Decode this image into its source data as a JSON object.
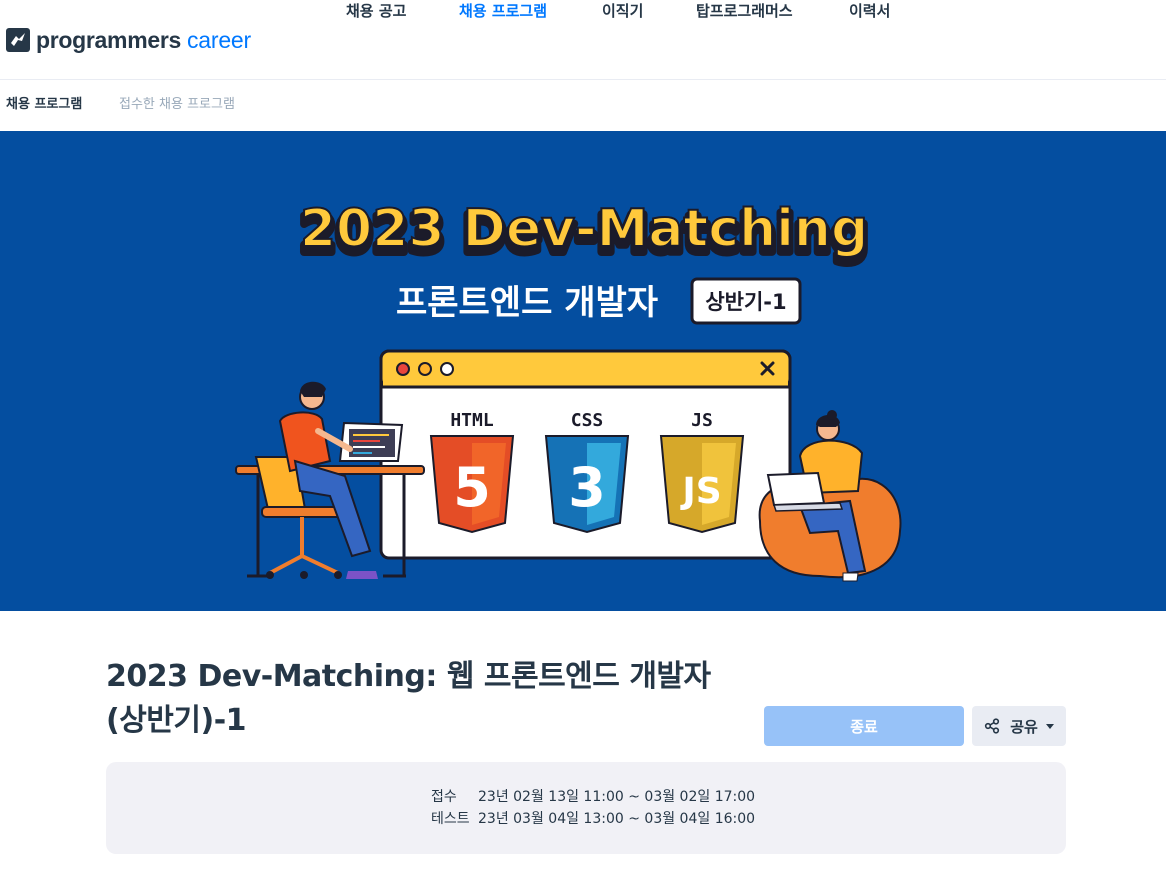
{
  "brand": {
    "name": "programmers",
    "suffix": "career",
    "accent_color": "#0078ff",
    "dark_color": "#263747"
  },
  "nav": {
    "items": [
      {
        "label": "채용 공고",
        "active": false
      },
      {
        "label": "채용 프로그램",
        "active": true
      },
      {
        "label": "이직기",
        "active": false
      },
      {
        "label": "탑프로그래머스",
        "active": false
      },
      {
        "label": "이력서",
        "active": false
      }
    ]
  },
  "subnav": {
    "items": [
      {
        "label": "채용 프로그램",
        "current": true
      },
      {
        "label": "접수한 채용 프로그램",
        "current": false
      }
    ]
  },
  "banner": {
    "background": "#044ea0",
    "headline": "2023 Dev-Matching",
    "subheadline": "프론트엔드 개발자",
    "badge": "상반기-1",
    "tech_labels": [
      "HTML",
      "CSS",
      "JS"
    ],
    "close_icon": "close-icon"
  },
  "program": {
    "title_line1": "2023 Dev-Matching: 웹 프론트엔드 개발자",
    "title_line2": "(상반기)-1",
    "status_button": "종료",
    "share_button": "공유",
    "share_icon": "share-icon",
    "schedule": [
      {
        "label": "접수",
        "value": "23년 02월 13일 11:00 ~ 03월 02일 17:00"
      },
      {
        "label": "테스트",
        "value": "23년 03월 04일 13:00 ~ 03월 04일 16:00"
      }
    ]
  }
}
